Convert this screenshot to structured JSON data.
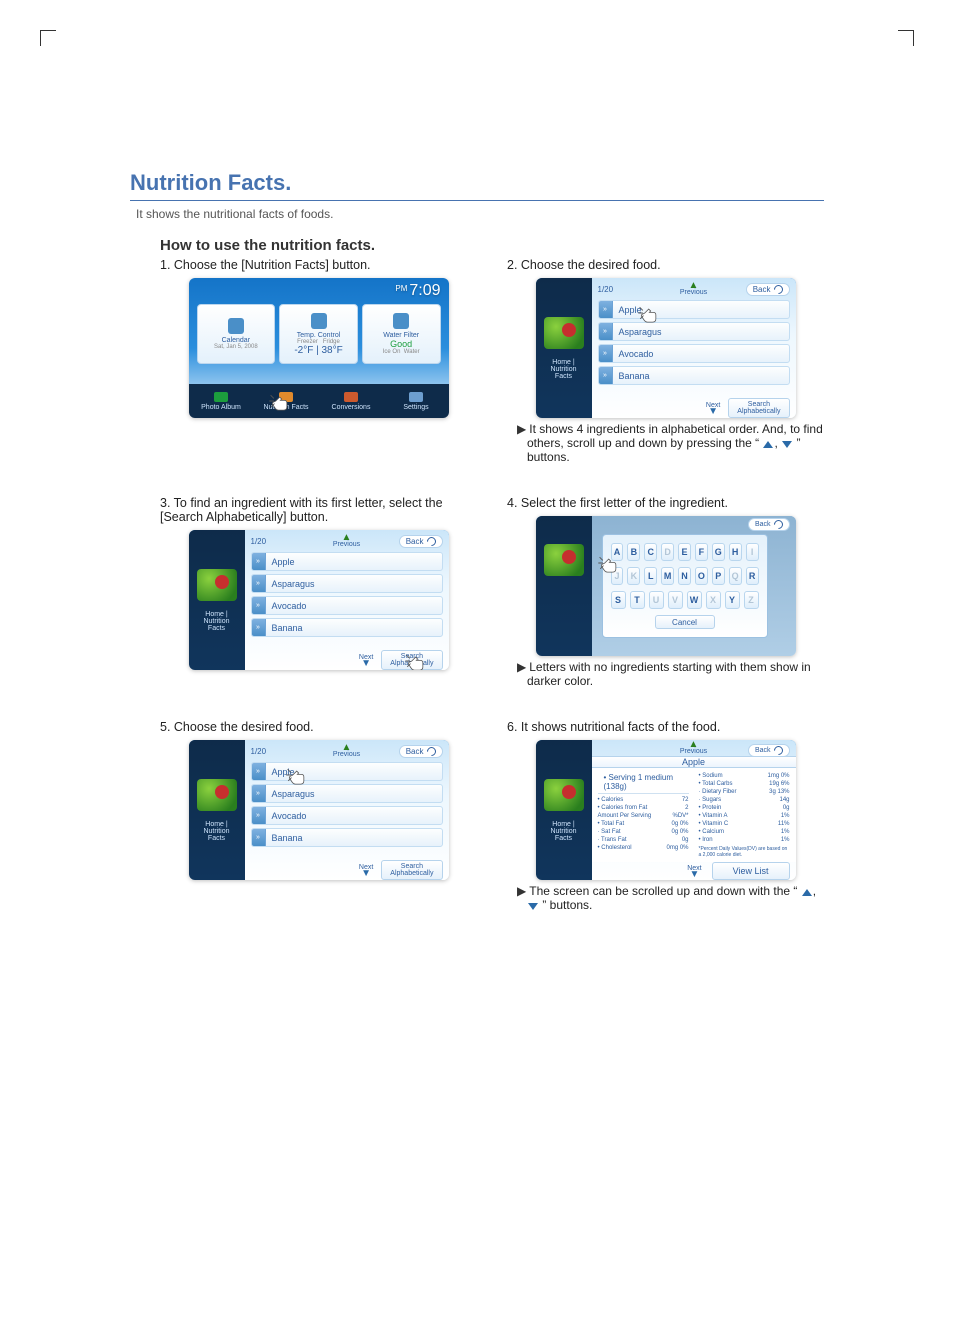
{
  "title": "Nutrition Facts.",
  "intro": "It shows the nutritional facts of foods.",
  "subtitle": "How to use the nutrition facts.",
  "steps": {
    "s1": {
      "cap": "1. Choose the [Nutrition Facts] button."
    },
    "s2": {
      "cap": "2. Choose the desired food.",
      "note1": "It shows 4 ingredients in alphabetical order. And, to find others, scroll up and down by pressing the “",
      "note2": "” buttons."
    },
    "s3": {
      "cap": "3. To find an ingredient with its first letter, select the [Search Alphabetically] button."
    },
    "s4": {
      "cap": "4. Select the first letter of the ingredient.",
      "note": "Letters with no ingredients starting with them show in darker color."
    },
    "s5": {
      "cap": "5. Choose the desired food."
    },
    "s6": {
      "cap": "6. It shows nutritional facts of the food.",
      "note1": "The screen can be scrolled up and down with the “",
      "note2": "” buttons."
    }
  },
  "home": {
    "time": "7:09",
    "ampm": "PM",
    "date": "Sat, Jan 5, 2008",
    "calendar": "Calendar",
    "temp": "Temp.\nControl",
    "freezer_lbl": "Freezer",
    "fridge_lbl": "Fridge",
    "freezer": "-2°F",
    "fridge": "38°F",
    "filter": "Water Filter",
    "status": "Good",
    "ice": "Ice On",
    "water": "Water",
    "bottom": [
      "Photo Album",
      "Nutrition Facts",
      "Conversions",
      "Settings"
    ]
  },
  "list": {
    "counter": "1/20",
    "previous": "Previous",
    "next": "Next",
    "back": "Back",
    "search": "Search\nAlphabetically",
    "side_home": "Home |",
    "side_title": "Nutrition\nFacts",
    "items": [
      "Apple",
      "Asparagus",
      "Avocado",
      "Banana"
    ]
  },
  "alpha": {
    "rows": [
      [
        "A",
        "B",
        "C",
        "D",
        "E",
        "F",
        "G",
        "H",
        "I"
      ],
      [
        "J",
        "K",
        "L",
        "M",
        "N",
        "O",
        "P",
        "Q",
        "R"
      ],
      [
        "S",
        "T",
        "U",
        "V",
        "W",
        "X",
        "Y",
        "Z"
      ]
    ],
    "dim": [
      "D",
      "I",
      "J",
      "K",
      "Q",
      "U",
      "V",
      "X",
      "Z"
    ],
    "cancel": "Cancel",
    "back": "Back",
    "side_peek": "rch\nAlphabetically"
  },
  "facts": {
    "name": "Apple",
    "previous": "Previous",
    "next": "Next",
    "back": "Back",
    "viewlist": "View List",
    "serving": "• Serving 1 medium (138g)",
    "left": [
      {
        "l": "• Calories",
        "v": "72"
      },
      {
        "l": "• Calories from Fat",
        "v": "2"
      },
      {
        "l": "Amount Per Serving",
        "v": "%DV*"
      },
      {
        "l": "• Total Fat",
        "v": "0g  0%"
      },
      {
        "l": "  · Sat Fat",
        "v": "0g  0%"
      },
      {
        "l": "  · Trans Fat",
        "v": "0g"
      },
      {
        "l": "• Cholesterol",
        "v": "0mg  0%"
      }
    ],
    "right": [
      {
        "l": "• Sodium",
        "v": "1mg  0%"
      },
      {
        "l": "• Total Carbs",
        "v": "19g  6%"
      },
      {
        "l": "  · Dietary Fiber",
        "v": "3g  13%"
      },
      {
        "l": "  · Sugars",
        "v": "14g"
      },
      {
        "l": "• Protein",
        "v": "0g"
      },
      {
        "l": "• Vitamin A",
        "v": "1%"
      },
      {
        "l": "• Vitamin C",
        "v": "11%"
      },
      {
        "l": "• Calcium",
        "v": "1%"
      },
      {
        "l": "• Iron",
        "v": "1%"
      }
    ],
    "foot": "*Percent Daily Values(DV) are based on a 2,000 calorie diet."
  }
}
